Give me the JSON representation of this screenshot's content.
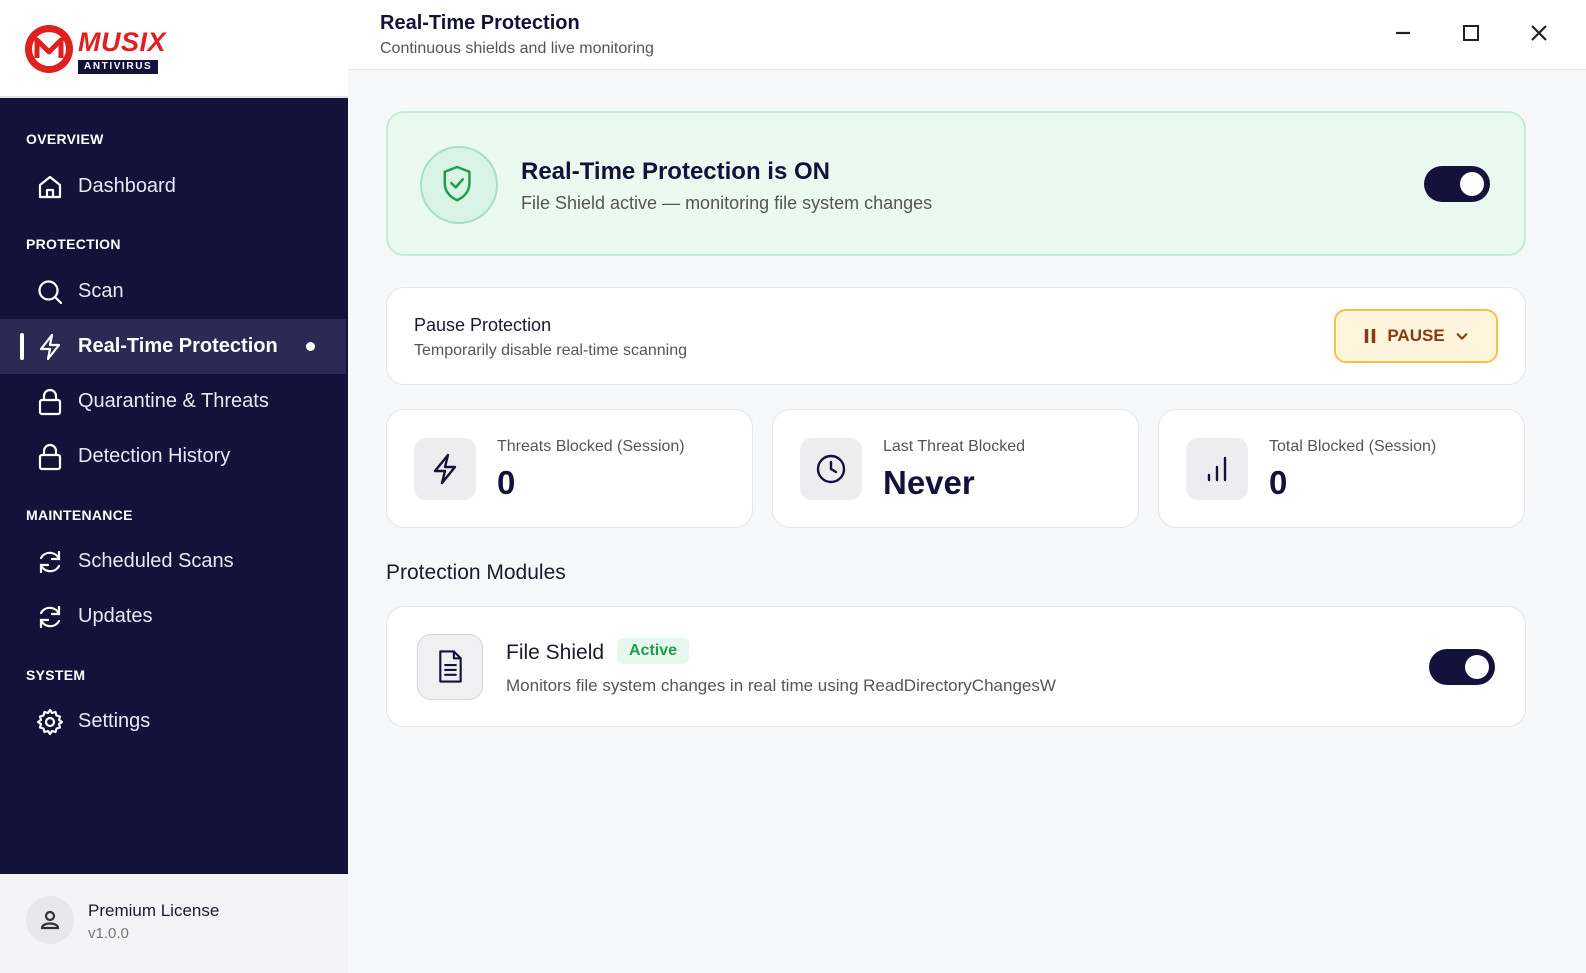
{
  "brand": {
    "name": "MUSIX",
    "sub": "ANTIVIRUS"
  },
  "sidebar": {
    "sections": [
      {
        "label": "OVERVIEW"
      },
      {
        "label": "PROTECTION"
      },
      {
        "label": "MAINTENANCE"
      },
      {
        "label": "SYSTEM"
      }
    ],
    "items": [
      {
        "label": "Dashboard",
        "icon": "home-icon"
      },
      {
        "label": "Scan",
        "icon": "search-icon"
      },
      {
        "label": "Real-Time Protection",
        "icon": "lightning-icon",
        "active": true
      },
      {
        "label": "Quarantine & Threats",
        "icon": "lock-icon"
      },
      {
        "label": "Detection History",
        "icon": "lock-icon"
      },
      {
        "label": "Scheduled Scans",
        "icon": "refresh-icon"
      },
      {
        "label": "Updates",
        "icon": "refresh-icon"
      },
      {
        "label": "Settings",
        "icon": "gear-icon"
      }
    ]
  },
  "license": {
    "title": "Premium License",
    "version": "v1.0.0"
  },
  "header": {
    "title": "Real-Time Protection",
    "subtitle": "Continuous shields and live monitoring"
  },
  "status": {
    "title": "Real-Time Protection is ON",
    "subtitle": "File Shield active — monitoring file system changes",
    "enabled": true
  },
  "pause": {
    "title": "Pause Protection",
    "subtitle": "Temporarily disable real-time scanning",
    "button_label": "PAUSE"
  },
  "stats": [
    {
      "label": "Threats Blocked (Session)",
      "value": "0",
      "icon": "lightning-icon"
    },
    {
      "label": "Last Threat Blocked",
      "value": "Never",
      "icon": "clock-icon"
    },
    {
      "label": "Total Blocked (Session)",
      "value": "0",
      "icon": "bar-chart-icon"
    }
  ],
  "modules": {
    "heading": "Protection Modules",
    "items": [
      {
        "title": "File Shield",
        "badge": "Active",
        "subtitle": "Monitors file system changes in real time using ReadDirectoryChangesW",
        "enabled": true,
        "icon": "document-icon"
      }
    ]
  },
  "colors": {
    "sidebar_bg": "#14123a",
    "accent_green": "#1f9d4d",
    "brand_red": "#e02020",
    "pause_border": "#f0c24a"
  }
}
